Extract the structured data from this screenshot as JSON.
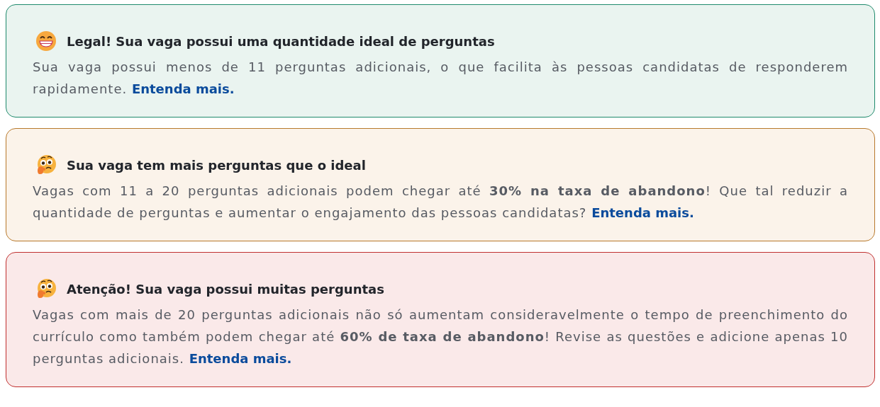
{
  "alerts": [
    {
      "kind": "success",
      "title": "Legal! Sua vaga possui uma quantidade ideal de perguntas",
      "text": "Sua vaga possui menos de 11 perguntas adicionais, o que facilita às pessoas candidatas de responderem rapidamente.",
      "link": "Entenda mais."
    },
    {
      "kind": "warning",
      "title": "Sua vaga tem mais perguntas que o ideal",
      "text": "Vagas com 11 a 20 perguntas adicionais podem chegar até **30% na taxa de abandono**! Que tal reduzir a quantidade de perguntas e aumentar o engajamento das pessoas candidatas?",
      "link": "Entenda mais."
    },
    {
      "kind": "danger",
      "title": "Atenção! Sua vaga possui muitas perguntas",
      "text": "Vagas com mais de 20 perguntas adicionais não só aumentam consideravelmente o tempo de preenchimento do currículo como também podem chegar até **60% de taxa de abandono**! Revise as questões e adicione apenas 10 perguntas adicionais.",
      "link": "Entenda mais."
    }
  ]
}
